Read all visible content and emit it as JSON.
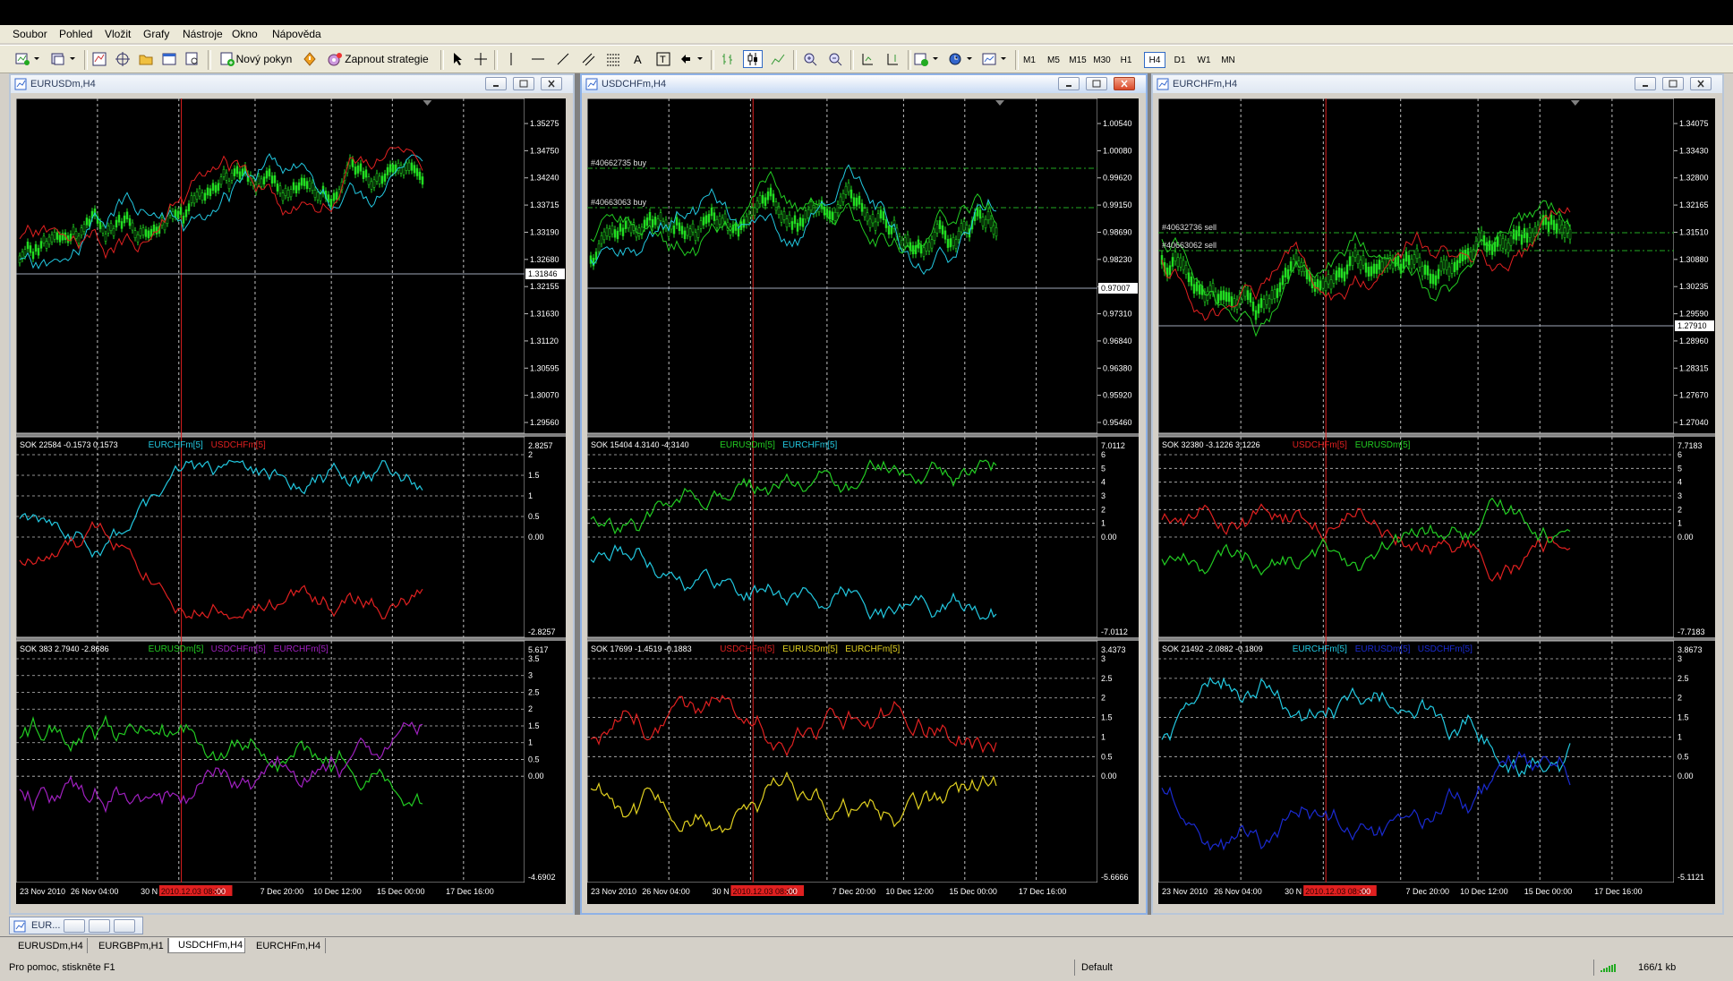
{
  "menu": [
    "Soubor",
    "Pohled",
    "Vložit",
    "Grafy",
    "Nástroje",
    "Okno",
    "Nápověda"
  ],
  "toolbar": {
    "new_order": "Nový pokyn",
    "autotrading": "Zapnout strategie",
    "timeframes": [
      "M1",
      "M5",
      "M15",
      "M30",
      "H1",
      "H4",
      "D1",
      "W1",
      "MN"
    ],
    "active_timeframe": "H4"
  },
  "windows": [
    {
      "title": "EURUSDm,H4",
      "price_axis": [
        "1.35275",
        "1.34750",
        "1.34240",
        "1.33715",
        "1.33190",
        "1.32680",
        "1.32155",
        "1.31630",
        "1.31120",
        "1.30595",
        "1.30070",
        "1.29560"
      ],
      "current_price": "1.31846",
      "orders": [],
      "ind1_label": "SOK 22584 -0.1573 0.1573",
      "ind1_legend": [
        {
          "text": "EURCHFm[5]",
          "color": "#22c8e0"
        },
        {
          "text": "USDCHFm[5]",
          "color": "#e02020"
        }
      ],
      "ind1_axis": [
        "2.8257",
        "2",
        "1.5",
        "1",
        "0.5",
        "0.00",
        "-2.8257"
      ],
      "ind2_label": "SOK 383 2.7940 -2.8686",
      "ind2_legend": [
        {
          "text": "EURUSDm[5]",
          "color": "#22cc22"
        },
        {
          "text": "USDCHFm[5]",
          "color": "#a020c0"
        },
        {
          "text": "EURCHFm[5]",
          "color": "#a020c0"
        }
      ],
      "ind2_axis": [
        "5.617",
        "3.5",
        "3",
        "2.5",
        "2",
        "1.5",
        "1",
        "0.5",
        "0.00",
        "-4.6902"
      ],
      "time_axis": [
        "23 Nov 2010",
        "26 Nov 04:00",
        "30 N",
        "2010.12.03 08:00",
        ":00",
        "7 Dec 20:00",
        "10 Dec 12:00",
        "15 Dec 00:00",
        "17 Dec 16:00"
      ]
    },
    {
      "title": "USDCHFm,H4",
      "price_axis": [
        "1.00540",
        "1.00080",
        "0.99620",
        "0.99150",
        "0.98690",
        "0.98230",
        "0.97770",
        "0.97310",
        "0.96840",
        "0.96380",
        "0.95920",
        "0.95460"
      ],
      "current_price": "0.97007",
      "orders": [
        "#40662735 buy",
        "#40663063 buy"
      ],
      "ind1_label": "SOK 15404 4.3140 -4.3140",
      "ind1_legend": [
        {
          "text": "EURUSDm[5]",
          "color": "#22cc22"
        },
        {
          "text": "EURCHFm[5]",
          "color": "#22c8e0"
        }
      ],
      "ind1_axis": [
        "7.0112",
        "6",
        "5",
        "4",
        "3",
        "2",
        "1",
        "0.00",
        "-7.0112"
      ],
      "ind2_label": "SOK 17699 -1.4519 -0.1883",
      "ind2_legend": [
        {
          "text": "USDCHFm[5]",
          "color": "#e02020"
        },
        {
          "text": "EURUSDm[5]",
          "color": "#e0d020"
        },
        {
          "text": "EURCHFm[5]",
          "color": "#e0d020"
        }
      ],
      "ind2_axis": [
        "3.4373",
        "3",
        "2.5",
        "2",
        "1.5",
        "1",
        "0.5",
        "0.00",
        "-5.6666"
      ],
      "time_axis": [
        "23 Nov 2010",
        "26 Nov 04:00",
        "30 N",
        "2010.12.03 08:00",
        ":00",
        "7 Dec 20:00",
        "10 Dec 12:00",
        "15 Dec 00:00",
        "17 Dec 16:00"
      ]
    },
    {
      "title": "EURCHFm,H4",
      "price_axis": [
        "1.34075",
        "1.33430",
        "1.32800",
        "1.32165",
        "1.31510",
        "1.30880",
        "1.30235",
        "1.29590",
        "1.28960",
        "1.28315",
        "1.27670",
        "1.27040"
      ],
      "current_price": "1.27910",
      "orders": [
        "#40632736 sell",
        "#40663062 sell"
      ],
      "ind1_label": "SOK 32380 -3.1226 3.1226",
      "ind1_legend": [
        {
          "text": "USDCHFm[5]",
          "color": "#e02020"
        },
        {
          "text": "EURUSDm[5]",
          "color": "#22cc22"
        }
      ],
      "ind1_axis": [
        "7.7183",
        "6",
        "5",
        "4",
        "3",
        "2",
        "1",
        "0.00",
        "-7.7183"
      ],
      "ind2_label": "SOK 21492 -2.0882 -0.1809",
      "ind2_legend": [
        {
          "text": "EURCHFm[5]",
          "color": "#22c8e0"
        },
        {
          "text": "EURUSDm[5]",
          "color": "#1a2ad0"
        },
        {
          "text": "USDCHFm[5]",
          "color": "#1a2ad0"
        }
      ],
      "ind2_axis": [
        "3.8673",
        "3",
        "2.5",
        "2",
        "1.5",
        "1",
        "0.5",
        "0.00",
        "-5.1121"
      ],
      "time_axis": [
        "23 Nov 2010",
        "26 Nov 04:00",
        "30 N",
        "2010.12.03 08:00",
        ":00",
        "7 Dec 20:00",
        "10 Dec 12:00",
        "15 Dec 00:00",
        "17 Dec 16:00"
      ]
    }
  ],
  "minimized_window": "EUR...",
  "tabs": [
    "EURUSDm,H4",
    "EURGBPm,H1",
    "USDCHFm,H4",
    "EURCHFm,H4"
  ],
  "active_tab": "USDCHFm,H4",
  "status": {
    "help": "Pro pomoc, stiskněte F1",
    "profile": "Default",
    "traffic": "166/1 kb"
  },
  "colors": {
    "chart_bg": "#000000",
    "candle": "#22dd22",
    "grid": "#c0c0c0",
    "sep_line": "#e02020",
    "order_line": "#22aa22"
  }
}
